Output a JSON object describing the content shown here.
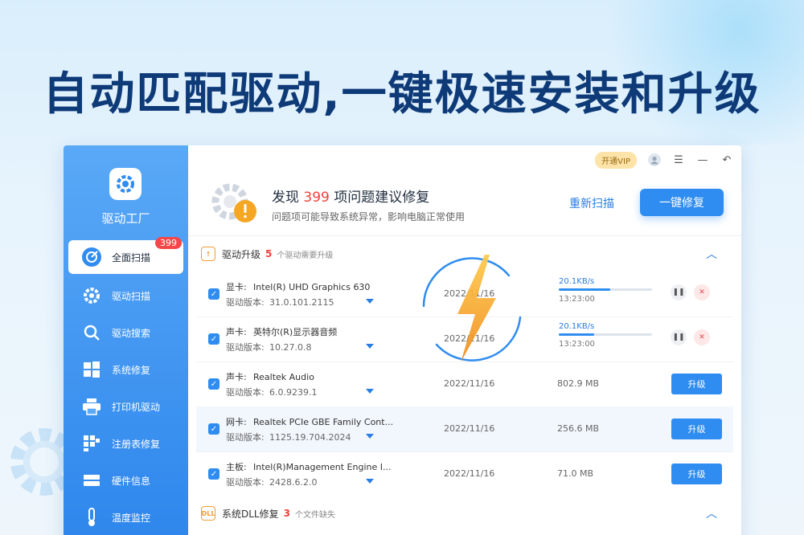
{
  "headline": "自动匹配驱动,一键极速安装和升级",
  "app": {
    "name": "驱动工厂"
  },
  "sidebar": {
    "items": [
      {
        "label": "全面扫描",
        "icon": "scan-target-icon",
        "badge": "399",
        "active": true
      },
      {
        "label": "驱动扫描",
        "icon": "gear-icon"
      },
      {
        "label": "驱动搜索",
        "icon": "search-icon"
      },
      {
        "label": "系统修复",
        "icon": "windows-icon"
      },
      {
        "label": "打印机驱动",
        "icon": "printer-icon"
      },
      {
        "label": "注册表修复",
        "icon": "registry-icon"
      },
      {
        "label": "硬件信息",
        "icon": "hardware-icon"
      },
      {
        "label": "温度监控",
        "icon": "thermometer-icon"
      }
    ]
  },
  "topbar": {
    "vip_label": "开通VIP"
  },
  "summary": {
    "title_prefix": "发现",
    "count": "399",
    "title_suffix": "项问题建议修复",
    "subtitle": "问题项可能导致系统异常，影响电脑正常使用",
    "rescan_label": "重新扫描",
    "fix_label": "一键修复"
  },
  "sections": {
    "drivers": {
      "icon_text": "↑",
      "title": "驱动升级",
      "count": "5",
      "desc": "个驱动需要升级"
    },
    "dll": {
      "icon_text": "DLL",
      "title": "系统DLL修复",
      "count": "3",
      "desc": "个文件缺失"
    }
  },
  "driver_rows": [
    {
      "device": "显卡:",
      "name": "Intel(R) UHD Graphics 630",
      "version_label": "驱动版本:",
      "version": "31.0.101.2115",
      "date": "2022/11/16",
      "state": "downloading",
      "speed": "20.1KB/s",
      "eta": "13:23:00",
      "progress": 0.55
    },
    {
      "device": "声卡:",
      "name": "英特尔(R)显示器音频",
      "version_label": "驱动版本:",
      "version": "10.27.0.8",
      "date": "2022/11/16",
      "state": "downloading",
      "speed": "20.1KB/s",
      "eta": "13:23:00",
      "progress": 0.38
    },
    {
      "device": "声卡:",
      "name": "Realtek Audio",
      "version_label": "驱动版本:",
      "version": "6.0.9239.1",
      "date": "2022/11/16",
      "state": "ready",
      "size": "802.9 MB",
      "button": "升级"
    },
    {
      "device": "网卡:",
      "name": "Realtek PCIe GBE Family Cont...",
      "version_label": "驱动版本:",
      "version": "1125.19.704.2024",
      "date": "2022/11/16",
      "state": "ready",
      "size": "256.6 MB",
      "button": "升级"
    },
    {
      "device": "主板:",
      "name": "Intel(R)Management Engine I...",
      "version_label": "驱动版本:",
      "version": "2428.6.2.0",
      "date": "2022/11/16",
      "state": "ready",
      "size": "71.0 MB",
      "button": "升级"
    }
  ],
  "colors": {
    "accent": "#2f8cf0",
    "alert": "#f2413a",
    "headline": "#0e3a78",
    "bolt": "#f5a623"
  }
}
